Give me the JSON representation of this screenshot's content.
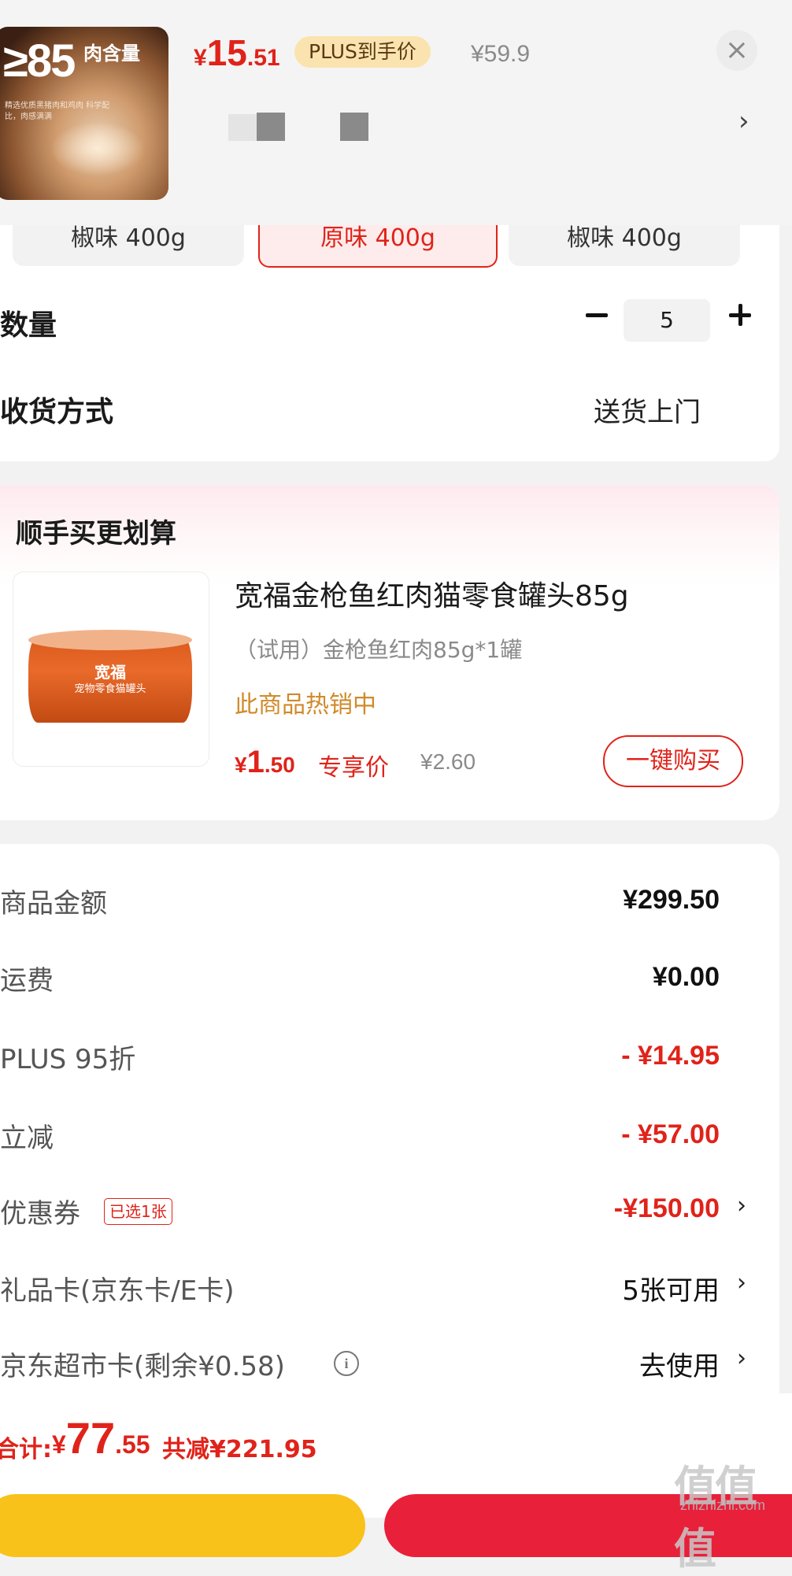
{
  "header": {
    "thumb": {
      "badge_big": "≥85",
      "badge_sub": "肉含量",
      "badge_note": "精选优质黑猪肉和鸡肉 科学配比，肉感满满"
    },
    "price": {
      "currency": "¥",
      "integer": "15",
      "decimal": ".51"
    },
    "plus_tag": "PLUS到手价",
    "original_price": "¥59.9",
    "close_icon": "×",
    "more_icon": "›"
  },
  "options": [
    {
      "label": "椒味 400g",
      "selected": false
    },
    {
      "label": "原味 400g",
      "selected": true
    },
    {
      "label": "椒味 400g",
      "selected": false
    }
  ],
  "quantity": {
    "label": "数量",
    "value": "5"
  },
  "shipping": {
    "label": "收货方式",
    "value": "送货上门"
  },
  "addon": {
    "title": "顺手买更划算",
    "image_brand": "宽福",
    "image_label": "宠物零食猫罐头",
    "name": "宽福金枪鱼红肉猫零食罐头85g",
    "spec": "（试用）金枪鱼红肉85g*1罐",
    "hot": "此商品热销中",
    "price": {
      "currency": "¥",
      "integer": "1",
      "decimal": ".50"
    },
    "price_tag": "专享价",
    "original_price": "¥2.60",
    "buy_label": "一键购买"
  },
  "summary": {
    "goods_label": "商品金额",
    "goods_value": "¥299.50",
    "freight_label": "运费",
    "freight_value": "¥0.00",
    "plus_label": "PLUS 95折",
    "plus_value": "- ¥14.95",
    "instant_label": "立减",
    "instant_value": "- ¥57.00",
    "coupon_label": "优惠券",
    "coupon_badge": "已选1张",
    "coupon_value": "-¥150.00",
    "giftcard_label": "礼品卡(京东卡/E卡)",
    "giftcard_value": "5张可用",
    "supermarket_label": "京东超市卡(剩余¥0.58)",
    "supermarket_value": "去使用",
    "chevron": "›",
    "info_icon": "i"
  },
  "footer": {
    "total_label": "合计:",
    "total": {
      "currency": "¥",
      "integer": "77",
      "decimal": ".55"
    },
    "saved": "共减¥221.95",
    "watermark": "值值值",
    "watermark_sub": "zhizhizhi.com"
  },
  "colors": {
    "accent_red": "#e0231a",
    "plus_gold": "#fbe3b0",
    "hot_orange": "#d08a2a",
    "btn_yellow": "#f9c21a",
    "btn_red": "#e8203a"
  }
}
